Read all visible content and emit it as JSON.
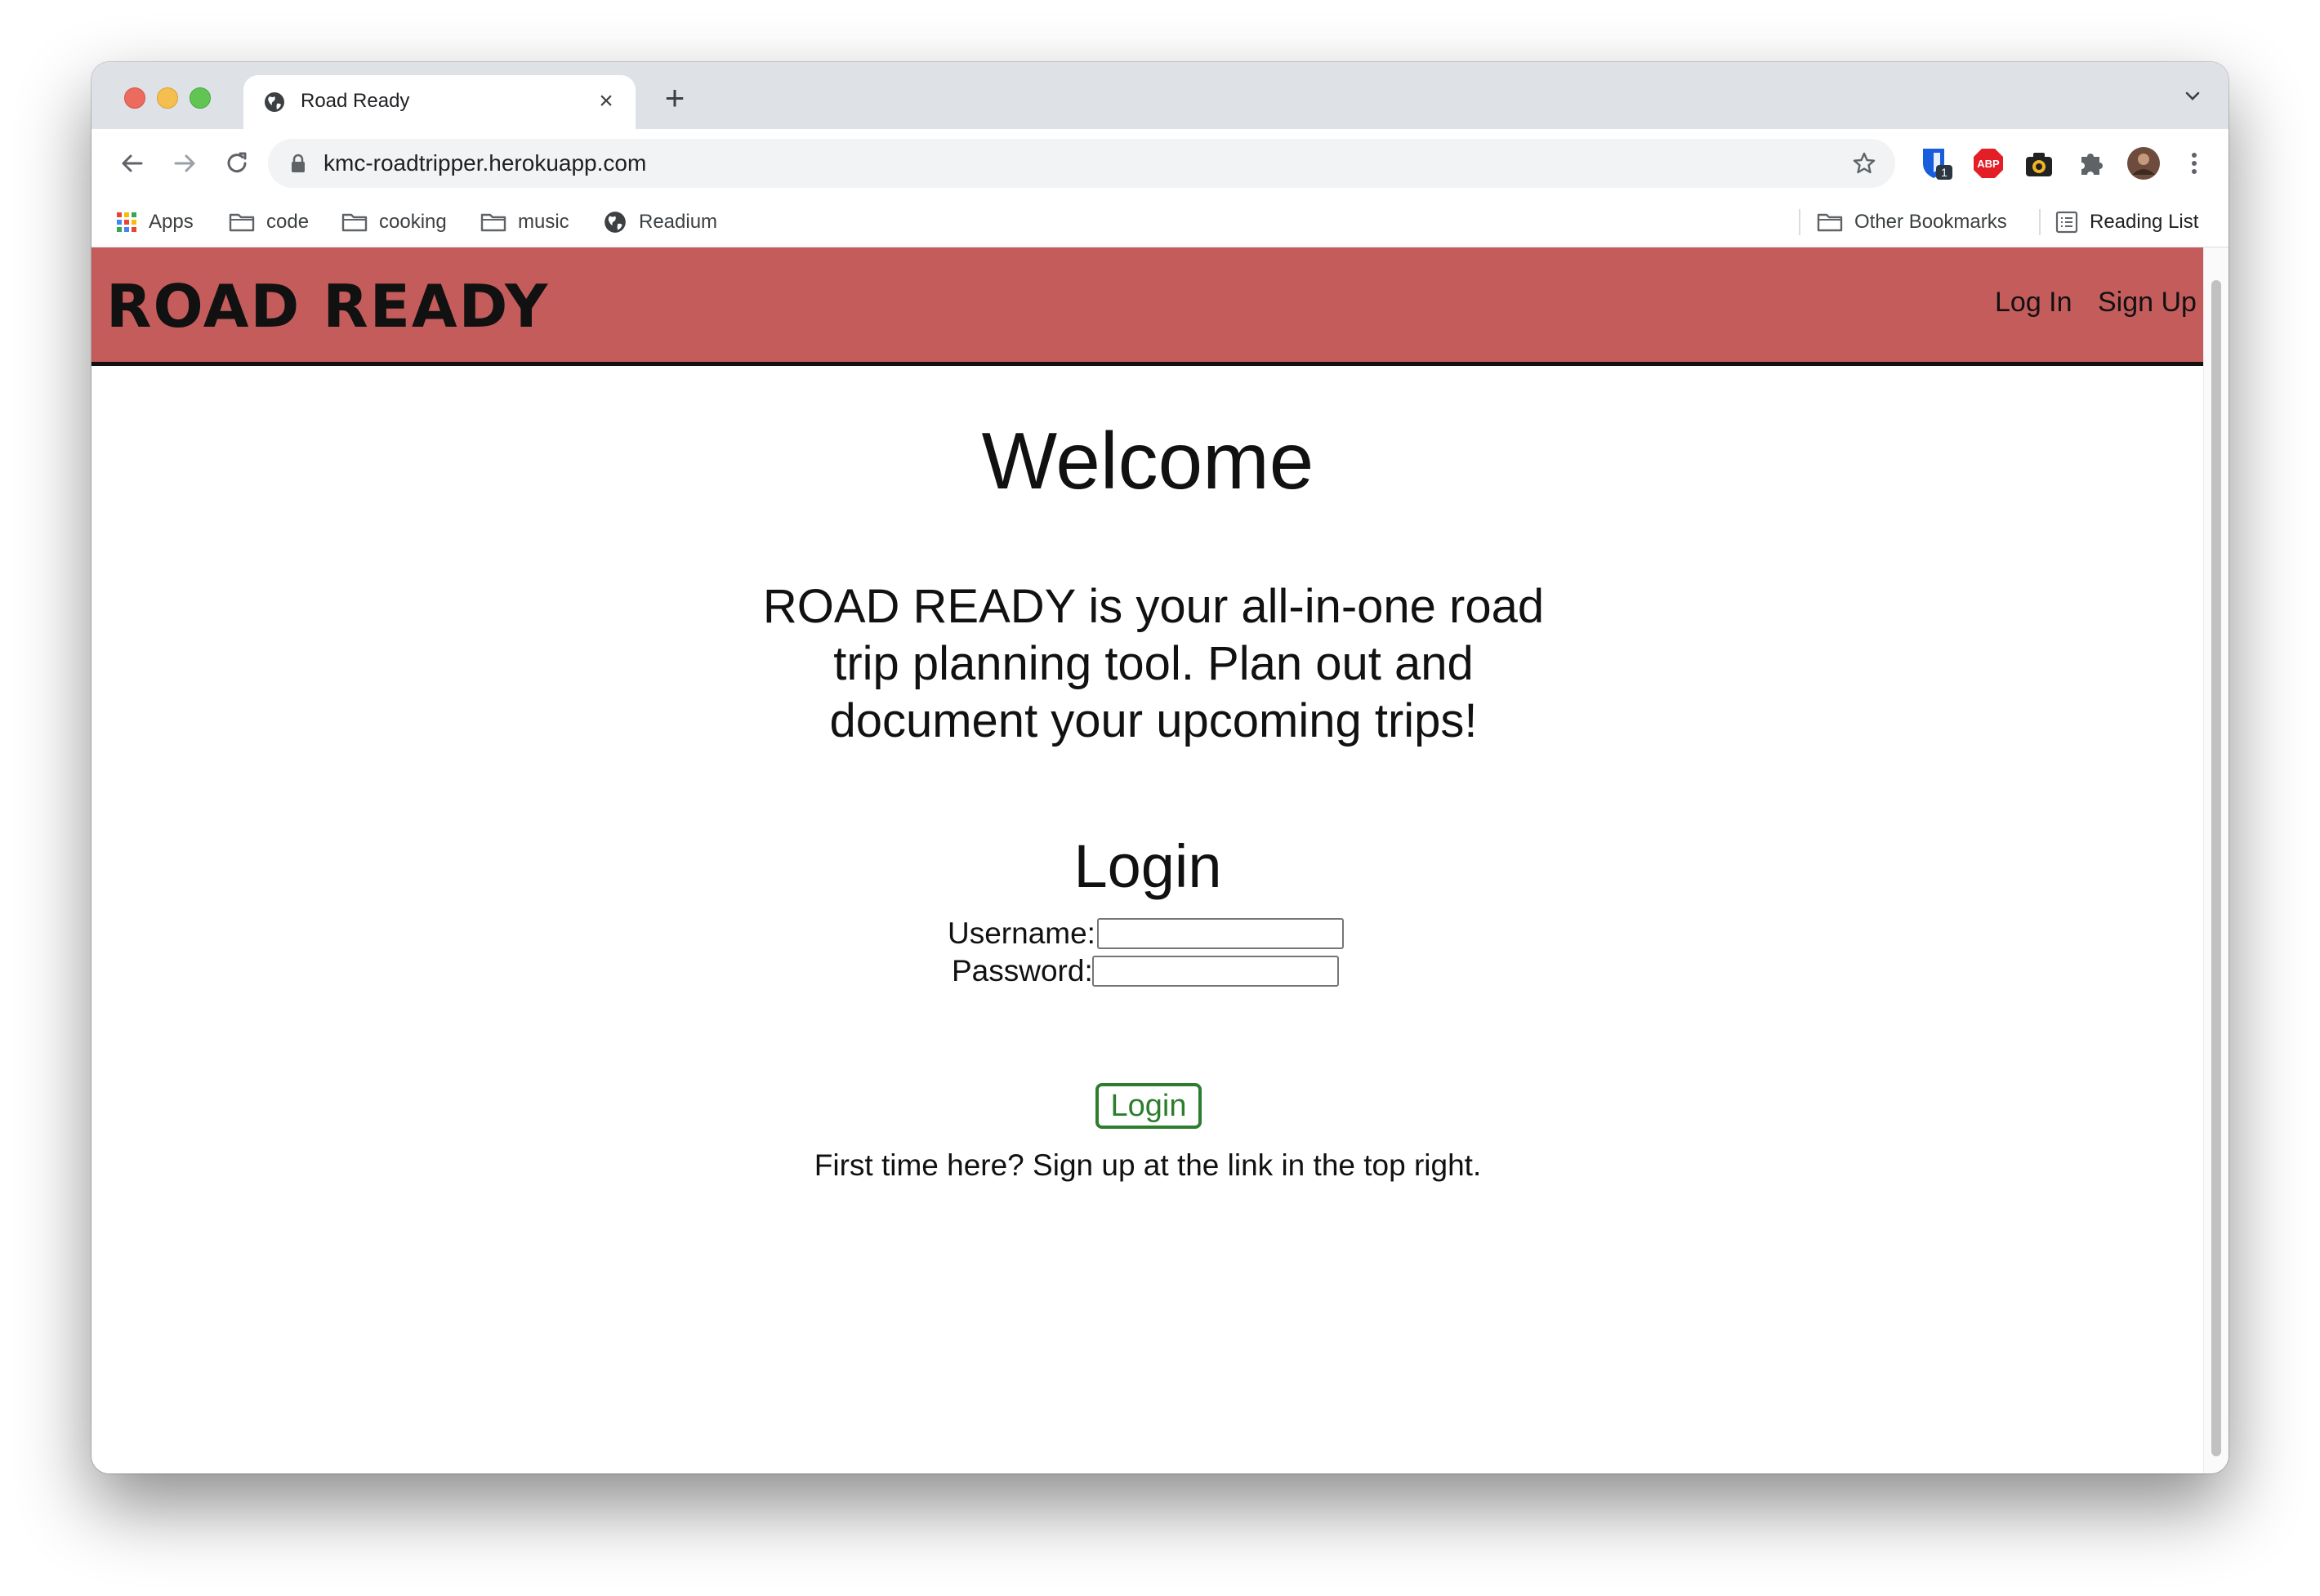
{
  "browser": {
    "tab_title": "Road Ready",
    "url": "kmc-roadtripper.herokuapp.com",
    "extension_badge": "1",
    "bookmarks": {
      "apps": "Apps",
      "items": [
        "code",
        "cooking",
        "music",
        "Readium"
      ],
      "other": "Other Bookmarks",
      "reading_list": "Reading List"
    },
    "icons": [
      "globe-icon",
      "close-icon",
      "plus-icon",
      "chevron-down-icon",
      "back-arrow-icon",
      "forward-arrow-icon",
      "reload-icon",
      "lock-icon",
      "star-icon",
      "bitwarden-icon",
      "adblock-icon",
      "camera-icon",
      "puzzle-icon",
      "avatar",
      "kebab-menu-icon",
      "apps-grid-icon",
      "folder-icon",
      "reading-list-icon"
    ]
  },
  "site": {
    "brand": "ROAD READY",
    "nav": {
      "login": "Log In",
      "signup": "Sign Up"
    },
    "header_color": "#c55c5c",
    "welcome": "Welcome",
    "tagline": "ROAD READY is your all-in-one road trip planning tool. Plan out and document your upcoming trips!",
    "login": {
      "title": "Login",
      "username_label": "Username:",
      "password_label": "Password:",
      "username_value": "",
      "password_value": "",
      "button": "Login",
      "button_color": "#2e7d2e"
    },
    "hint": "First time here? Sign up at the link in the top right."
  }
}
